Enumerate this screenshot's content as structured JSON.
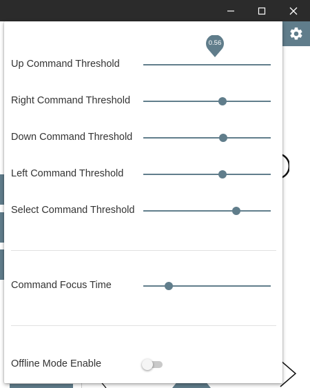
{
  "window": {
    "controls": {
      "minimize_icon": "minimize-icon",
      "maximize_icon": "maximize-icon",
      "close_icon": "close-icon"
    },
    "titlebar_color": "#2b2b2b"
  },
  "background_app": {
    "header_color": "#607d8b",
    "settings_icon": "gear-icon"
  },
  "settings": {
    "accent_color": "#607d8b",
    "thresholds": [
      {
        "label": "Up Command Threshold",
        "value": 0.56,
        "value_label": "0.56",
        "show_value": true
      },
      {
        "label": "Right Command Threshold",
        "value": 0.62,
        "show_value": false
      },
      {
        "label": "Down Command Threshold",
        "value": 0.625,
        "show_value": false
      },
      {
        "label": "Left Command Threshold",
        "value": 0.62,
        "show_value": false
      },
      {
        "label": "Select Command Threshold",
        "value": 0.73,
        "show_value": false
      }
    ],
    "focus_time": {
      "label": "Command Focus Time",
      "value": 0.2
    },
    "offline_mode": {
      "label": "Offline Mode Enable",
      "enabled": false
    }
  }
}
